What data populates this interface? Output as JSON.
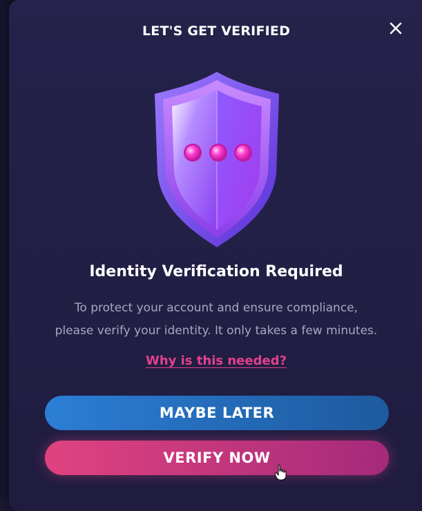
{
  "dialog": {
    "title": "LET'S GET VERIFIED",
    "close_icon": "close-icon",
    "illustration": "shield-icon",
    "heading": "Identity Verification Required",
    "body_line1": "To protect your account and ensure compliance,",
    "body_line2": "please verify your identity. It only takes a few minutes.",
    "help_link": "Why is this needed?",
    "secondary_button": "MAYBE LATER",
    "primary_button": "VERIFY NOW"
  },
  "colors": {
    "panel": "#23204a",
    "link": "#e2418d",
    "secondary_button": "#2c7ed6",
    "primary_button": "#e0437f"
  }
}
